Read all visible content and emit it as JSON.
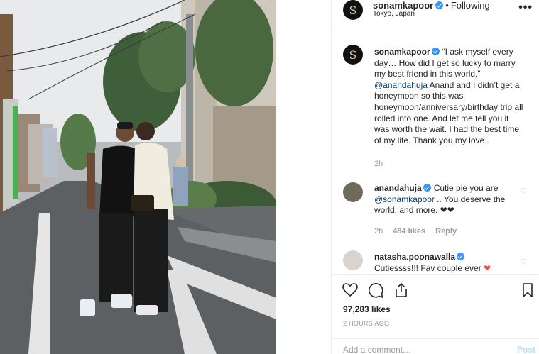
{
  "post": {
    "header": {
      "username": "sonamkapoor",
      "separator": "•",
      "follow_status": "Following",
      "location": "Tokyo, Japan",
      "more_label": "•••",
      "avatar_letter": "S"
    },
    "caption": {
      "username": "sonamkapoor",
      "text_1": "“I ask myself every day… How did I get so lucky to marry my best friend in this world.”",
      "mention": "@anandahuja",
      "text_2": " Anand and I didn’t get a honeymoon so this was honeymoon/anniversary/birthday trip all rolled into one. And let me tell you it was worth the wait. I had the best time of my life. Thank you my love .",
      "time": "2h"
    },
    "comments": [
      {
        "username": "anandahuja",
        "text_1": "Cutie pie you are ",
        "mention": "@sonamkapoor",
        "text_2": " .. You deserve the world, and more. ❤❤",
        "time": "2h",
        "likes": "484 likes",
        "reply": "Reply"
      },
      {
        "username": "natasha.poonawalla",
        "text": "Cutiessss!!! Fav couple ever",
        "emoji": "❤"
      }
    ],
    "likes_count": "97,283 likes",
    "time_ago": "2 HOURS AGO",
    "add_comment": {
      "placeholder": "Add a comment…",
      "post_label": "Post"
    },
    "colors": {
      "accent": "#3897f0",
      "text": "#262626",
      "muted": "#999999",
      "border": "#efefef"
    },
    "icons": [
      "heart-icon",
      "comment-icon",
      "share-icon",
      "bookmark-icon",
      "verified-badge-icon",
      "more-options-icon"
    ]
  }
}
